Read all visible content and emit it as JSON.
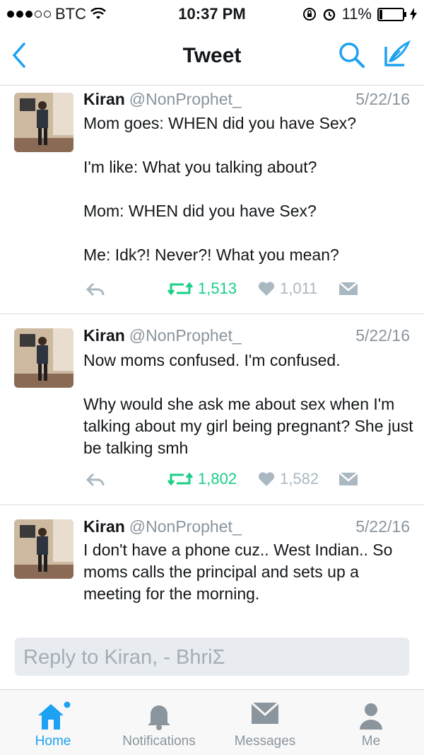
{
  "status_bar": {
    "carrier": "BTC",
    "time": "10:37 PM",
    "battery": "11%"
  },
  "nav": {
    "title": "Tweet",
    "back_icon": "chevron-left-icon",
    "search_icon": "search-icon",
    "compose_icon": "compose-icon"
  },
  "tweets": [
    {
      "name": "Kiran",
      "handle": "@NonProphet_",
      "date": "5/22/16",
      "text": "Mom goes: WHEN did you have Sex?\n\nI'm like: What you talking about?\n\nMom: WHEN did you have Sex?\n\nMe: Idk?! Never?! What you mean?",
      "retweets": "1,513",
      "likes": "1,011"
    },
    {
      "name": "Kiran",
      "handle": "@NonProphet_",
      "date": "5/22/16",
      "text": "Now moms confused. I'm confused.\n\nWhy would she ask me about sex when I'm talking about my girl being pregnant? She just be talking smh",
      "retweets": "1,802",
      "likes": "1,582"
    },
    {
      "name": "Kiran",
      "handle": "@NonProphet_",
      "date": "5/22/16",
      "text": "I don't have a phone cuz.. West Indian.. So moms calls the principal and sets up a meeting for the morning."
    }
  ],
  "reply": {
    "placeholder": "Reply to Kiran, - BhriΣ"
  },
  "tabs": [
    {
      "label": "Home",
      "icon": "home-icon"
    },
    {
      "label": "Notifications",
      "icon": "bell-icon"
    },
    {
      "label": "Messages",
      "icon": "envelope-icon"
    },
    {
      "label": "Me",
      "icon": "person-icon"
    }
  ],
  "colors": {
    "accent": "#1da1f2",
    "retweet": "#19cf86",
    "muted": "#8a959e"
  }
}
